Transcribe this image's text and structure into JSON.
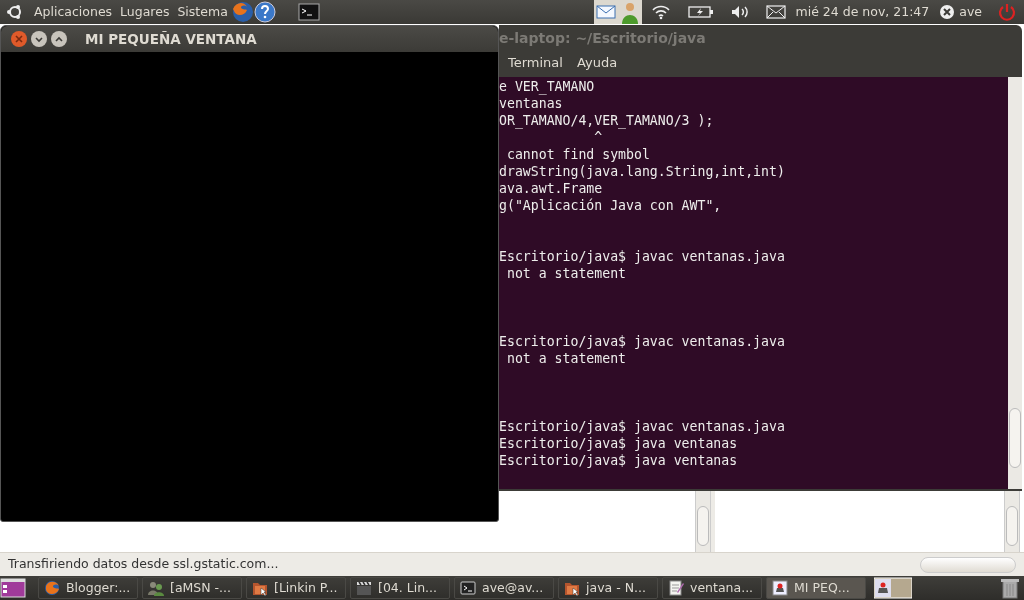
{
  "top_panel": {
    "menus": [
      "Aplicaciones",
      "Lugares",
      "Sistema"
    ],
    "clock": "mié 24 de nov, 21:47",
    "user": "ave"
  },
  "browser": {
    "status": "Transfiriendo datos desde ssl.gstatic.com...",
    "progress": {
      "level": 0
    }
  },
  "terminal": {
    "title": "e-laptop: ~/Escritorio/java",
    "menu": [
      "Terminal",
      "Ayuda"
    ],
    "lines": [
      {
        "kind": "text",
        "text": "e VER_TAMANO"
      },
      {
        "kind": "text",
        "text": "ventanas"
      },
      {
        "kind": "text",
        "text": "OR_TAMANO/4,VER_TAMANO/3 );"
      },
      {
        "kind": "text",
        "text": "            ^"
      },
      {
        "kind": "text",
        "text": " cannot find symbol"
      },
      {
        "kind": "text",
        "text": "drawString(java.lang.String,int,int)"
      },
      {
        "kind": "text",
        "text": "ava.awt.Frame"
      },
      {
        "kind": "text",
        "text": "g(\"Aplicación Java con AWT\","
      },
      {
        "kind": "blank"
      },
      {
        "kind": "blank"
      },
      {
        "kind": "text",
        "text": "Escritorio/java$ javac ventanas.java"
      },
      {
        "kind": "text",
        "text": " not a statement"
      },
      {
        "kind": "blank"
      },
      {
        "kind": "blank"
      },
      {
        "kind": "blank"
      },
      {
        "kind": "text",
        "text": "Escritorio/java$ javac ventanas.java"
      },
      {
        "kind": "text",
        "text": " not a statement"
      },
      {
        "kind": "blank"
      },
      {
        "kind": "blank"
      },
      {
        "kind": "blank"
      },
      {
        "kind": "text",
        "text": "Escritorio/java$ javac ventanas.java"
      },
      {
        "kind": "text",
        "text": "Escritorio/java$ java ventanas"
      },
      {
        "kind": "text",
        "text": "Escritorio/java$ java ventanas"
      }
    ]
  },
  "window": {
    "title": "MI PEQUEÑA VENTANA"
  },
  "taskbar": {
    "tasks": [
      {
        "label": "Blogger:...",
        "kind": "browser",
        "selected": false
      },
      {
        "label": "[aMSN -...",
        "kind": "people",
        "selected": false
      },
      {
        "label": "[Linkin P...",
        "kind": "folder",
        "selected": false
      },
      {
        "label": "[04. Lin...",
        "kind": "clapper",
        "selected": false
      },
      {
        "label": "ave@av...",
        "kind": "terminal",
        "selected": false
      },
      {
        "label": "java - N...",
        "kind": "folder",
        "selected": false
      },
      {
        "label": "ventana...",
        "kind": "editor",
        "selected": false
      },
      {
        "label": "MI PEQ...",
        "kind": "java",
        "selected": true
      }
    ]
  }
}
